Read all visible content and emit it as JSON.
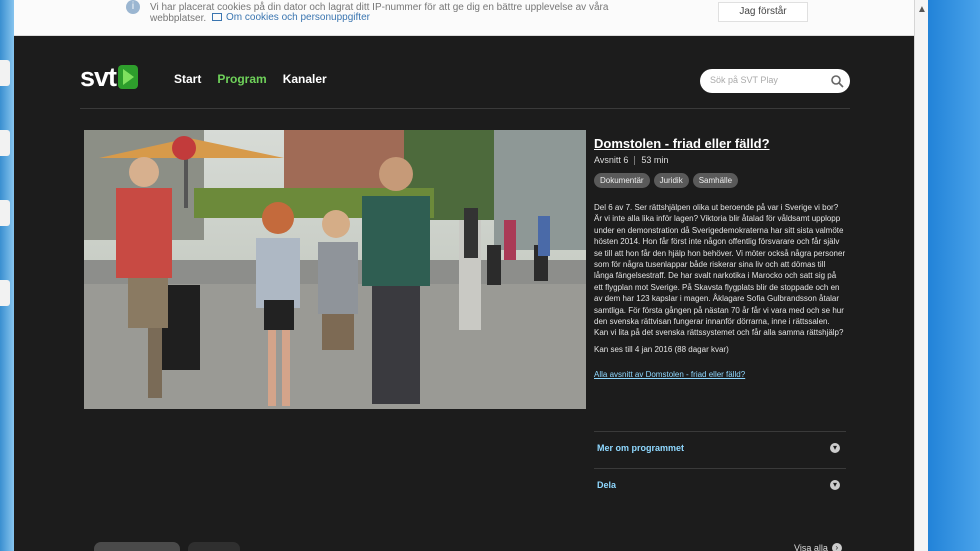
{
  "cookie_banner": {
    "message": "Vi har placerat cookies på din dator och lagrat ditt IP-nummer för att ge dig en bättre upplevelse av våra webbplatser.",
    "link": "Om cookies och personuppgifter",
    "accept_label": "Jag förstår"
  },
  "header": {
    "logo": "svt",
    "nav": [
      "Start",
      "Program",
      "Kanaler"
    ],
    "active_nav": "Program",
    "search_placeholder": "Sök på SVT Play"
  },
  "episode": {
    "title": "Domstolen - friad eller fälld?",
    "episode_label": "Avsnitt 6",
    "duration": "53 min",
    "tags": [
      "Dokumentär",
      "Juridik",
      "Samhälle"
    ],
    "description": "Del 6 av 7. Ser rättshjälpen olika ut beroende på var i Sverige vi bor? Är vi inte alla lika inför lagen? Viktoria blir åtalad för våldsamt upplopp under en demonstration då Sverigedemokraterna har sitt sista valmöte hösten 2014. Hon får först inte någon offentlig försvarare och får själv se till att hon får den hjälp hon behöver. Vi möter också några personer som för några tusenlappar både riskerar sina liv och att dömas till långa fängelsestraff. De har svalt narkotika i Marocko och satt sig på ett flygplan mot Sverige. På Skavsta flygplats blir de stoppade och en av dem har 123 kapslar i magen. Åklagare Sofia Gulbrandsson åtalar samtliga. För första gången på nästan 70 år får vi vara med och se hur den svenska rättvisan fungerar innanför dörrarna, inne i rättssalen. Kan vi lita på det svenska rättssystemet och får alla samma rättshjälp?",
    "available_until": "Kan ses till 4 jan 2016 (88 dagar kvar)",
    "all_episodes_link": "Alla avsnitt av Domstolen - friad eller fälld?"
  },
  "accordion": [
    "Mer om programmet",
    "Dela"
  ],
  "bottom": {
    "visa_alla": "Visa alla"
  },
  "colors": {
    "background": "#1c1c1c",
    "accent_green": "#6fd25a",
    "link_blue": "#8fd8ff"
  }
}
